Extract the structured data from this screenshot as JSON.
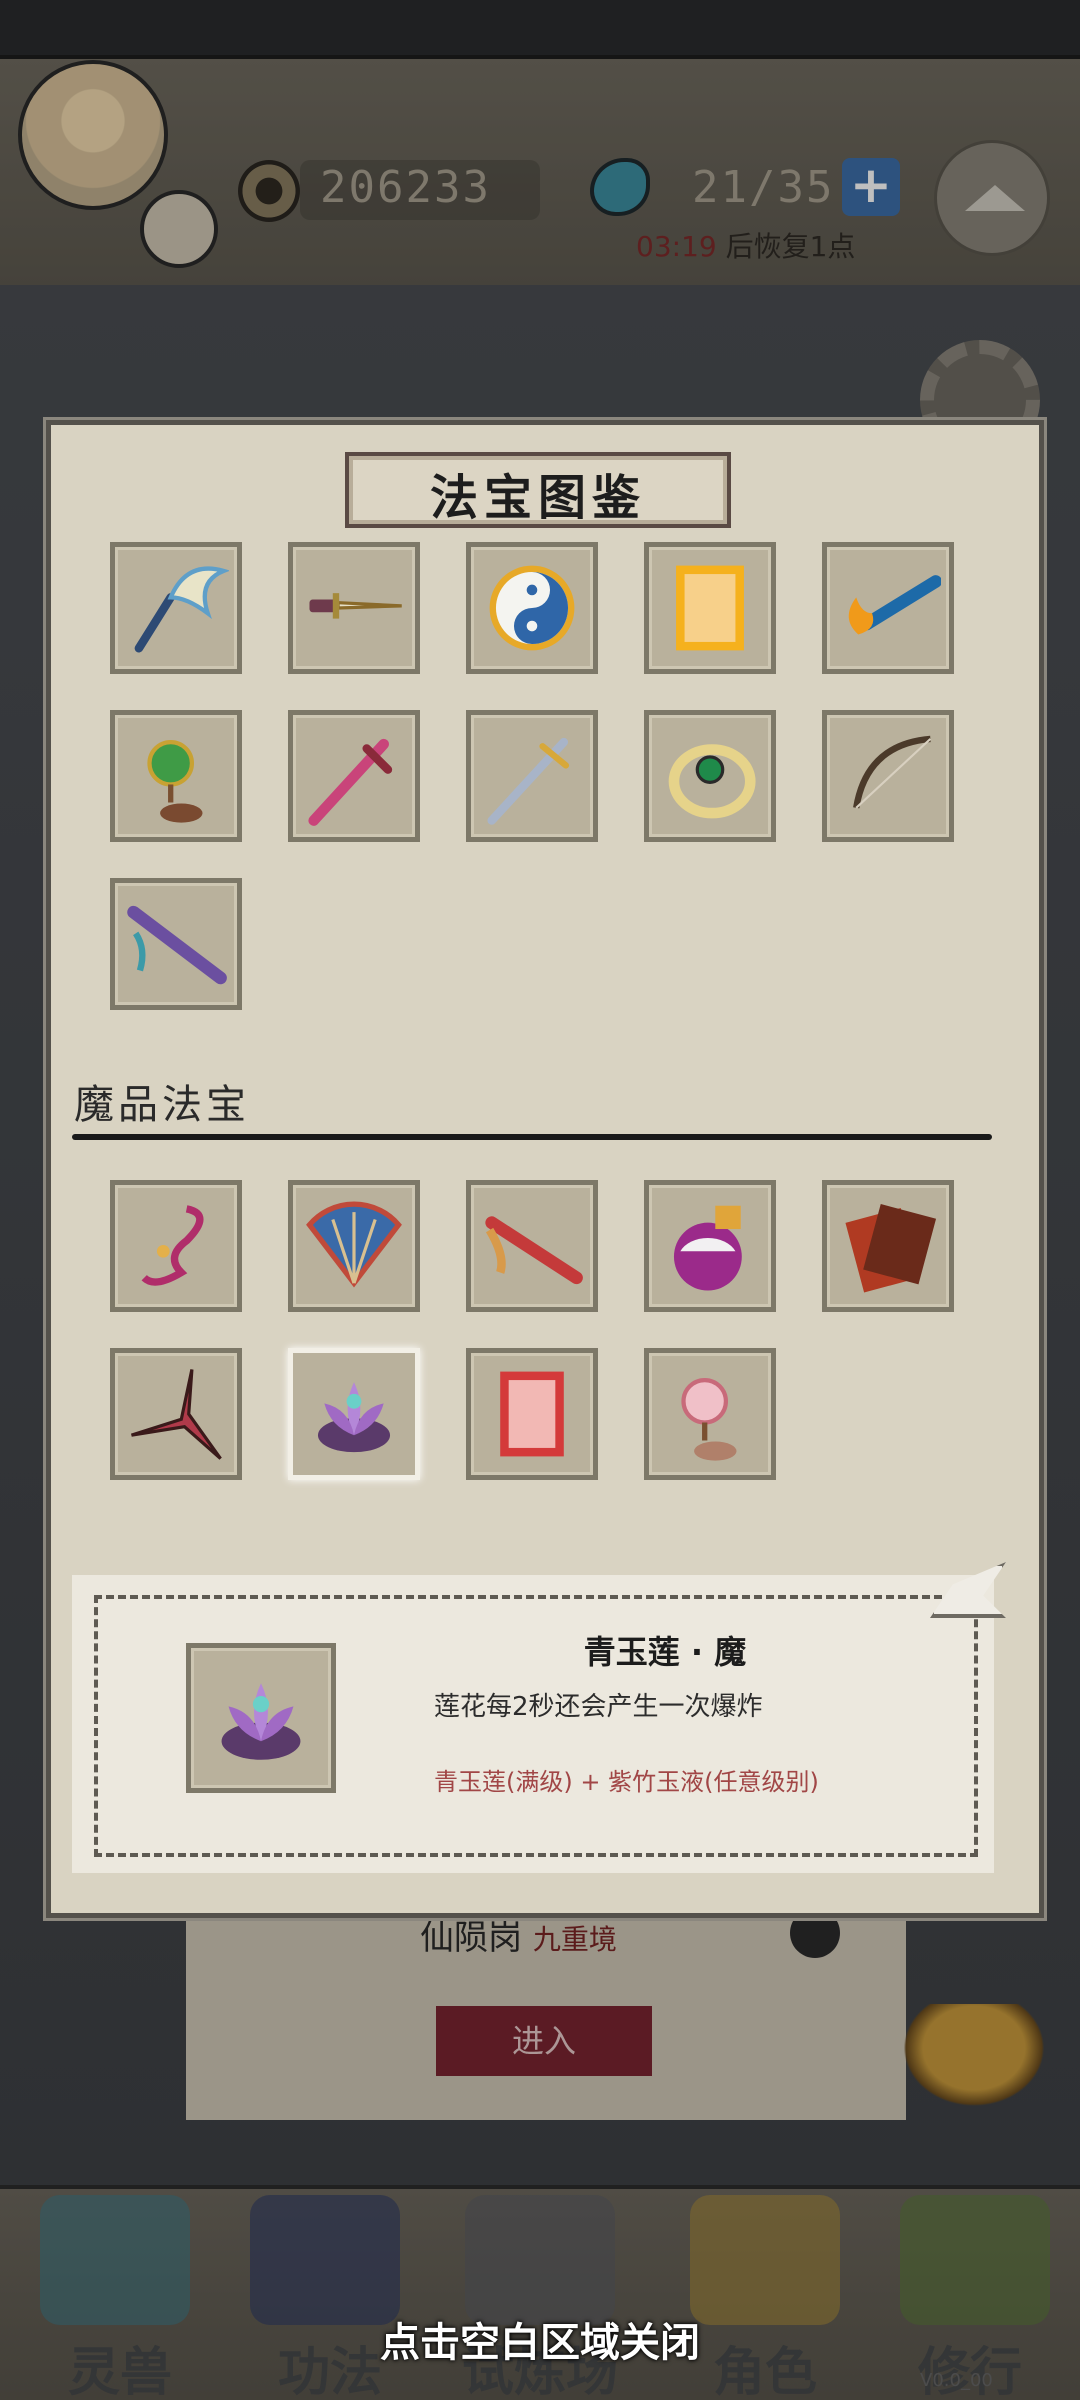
{
  "header": {
    "coins": "206233",
    "energy": "21/35",
    "recover_time": "03:19",
    "recover_label": "后恢复1点"
  },
  "background": {
    "dungeon_name": "仙陨岗",
    "dungeon_level": "九重境",
    "enter_label": "进入"
  },
  "modal": {
    "title": "法宝图鉴",
    "normal_items": [
      "whisk-icon",
      "dagger-icon",
      "yin-yang-icon",
      "golden-talisman-icon",
      "fire-brush-icon",
      "jade-pendant-icon",
      "crimson-sword-icon",
      "steel-sword-icon",
      "jade-ring-icon",
      "bow-icon",
      "flute-icon"
    ],
    "demon_section_title": "魔品法宝",
    "demon_items": [
      "demon-pendant-icon",
      "demon-fan-icon",
      "red-flute-icon",
      "purple-potion-icon",
      "demon-scroll-icon",
      "shuriken-icon",
      "purple-lotus-icon",
      "red-talisman-icon",
      "demon-jade-pendant-icon"
    ],
    "selected_index": 6
  },
  "detail": {
    "name": "青玉莲 · 魔",
    "description": "莲花每2秒还会产生一次爆炸",
    "recipe": "青玉莲(满级) + 紫竹玉液(任意级别)",
    "icon": "purple-lotus-icon"
  },
  "nav": {
    "items": [
      "灵兽",
      "功法",
      "试炼场",
      "角色",
      "修行"
    ]
  },
  "close_hint": "点击空白区域关闭",
  "version": "V0.0_00",
  "colors": {
    "parchment": "#d9d3c2",
    "slot": "#b9b19c",
    "recipe": "#a14646",
    "enter_button": "#7a2530"
  }
}
